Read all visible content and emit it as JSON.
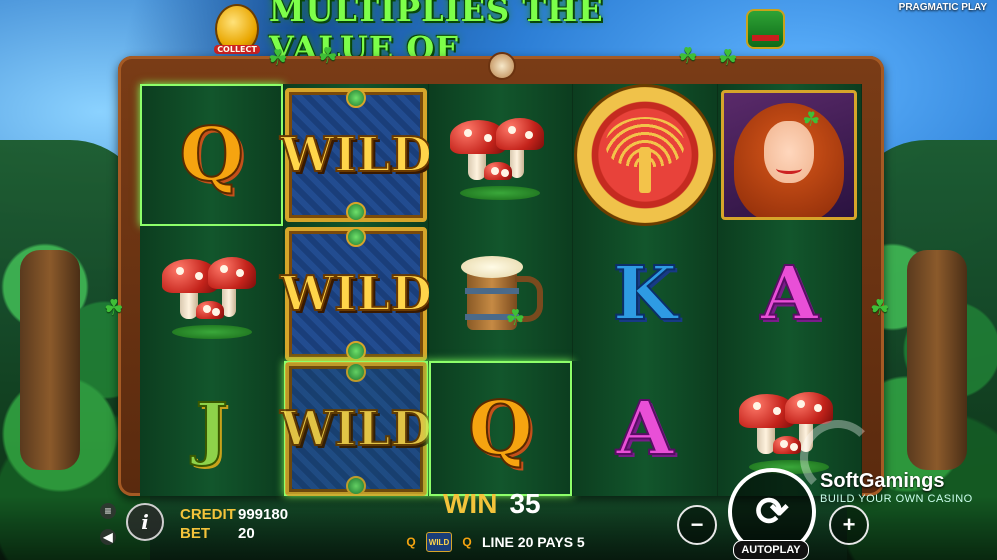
{
  "provider": "PRAGMATIC PLAY",
  "banner": {
    "text": "MULTIPLIES THE VALUE OF",
    "coin_label": "COLLECT"
  },
  "reels": [
    [
      {
        "symbol": "Q",
        "kind": "letter",
        "color": "#f6a410",
        "highlight": true
      },
      {
        "symbol": "mushroom",
        "kind": "mushroom"
      },
      {
        "symbol": "J",
        "kind": "letter",
        "color": "#8ed24a"
      }
    ],
    [
      {
        "symbol": "WILD",
        "kind": "wild"
      },
      {
        "symbol": "WILD",
        "kind": "wild"
      },
      {
        "symbol": "WILD",
        "kind": "wild",
        "highlight": true
      }
    ],
    [
      {
        "symbol": "mushroom",
        "kind": "mushroom"
      },
      {
        "symbol": "beer-mug",
        "kind": "mug"
      },
      {
        "symbol": "Q",
        "kind": "letter",
        "color": "#f6a410",
        "highlight": true
      }
    ],
    [
      {
        "symbol": "tree-of-life-coin",
        "kind": "coin"
      },
      {
        "symbol": "K",
        "kind": "letter",
        "color": "#2e9be3"
      },
      {
        "symbol": "A",
        "kind": "letter",
        "color": "#e94fd7"
      }
    ],
    [
      {
        "symbol": "red-haired-lady",
        "kind": "lady"
      },
      {
        "symbol": "A",
        "kind": "letter",
        "color": "#e94fd7"
      },
      {
        "symbol": "mushroom",
        "kind": "mushroom"
      }
    ]
  ],
  "status": {
    "credit_label": "CREDIT",
    "credit_value": "999180",
    "bet_label": "BET",
    "bet_value": "20",
    "win_label": "WIN",
    "win_value": "35",
    "line_text": "LINE 20 PAYS 5",
    "mini_wild": "WILD",
    "mini_q": "Q"
  },
  "controls": {
    "autoplay_label": "AUTOPLAY",
    "minus": "−",
    "plus": "+",
    "info": "i",
    "spin_icon": "⟳"
  },
  "watermark": {
    "brand": "SoftGamings",
    "tag": "BUILD YOUR OWN CASINO"
  },
  "colors": {
    "accent_gold": "#f3c33b",
    "highlight_green": "#8dff6a",
    "title_green": "#7dff4a"
  }
}
